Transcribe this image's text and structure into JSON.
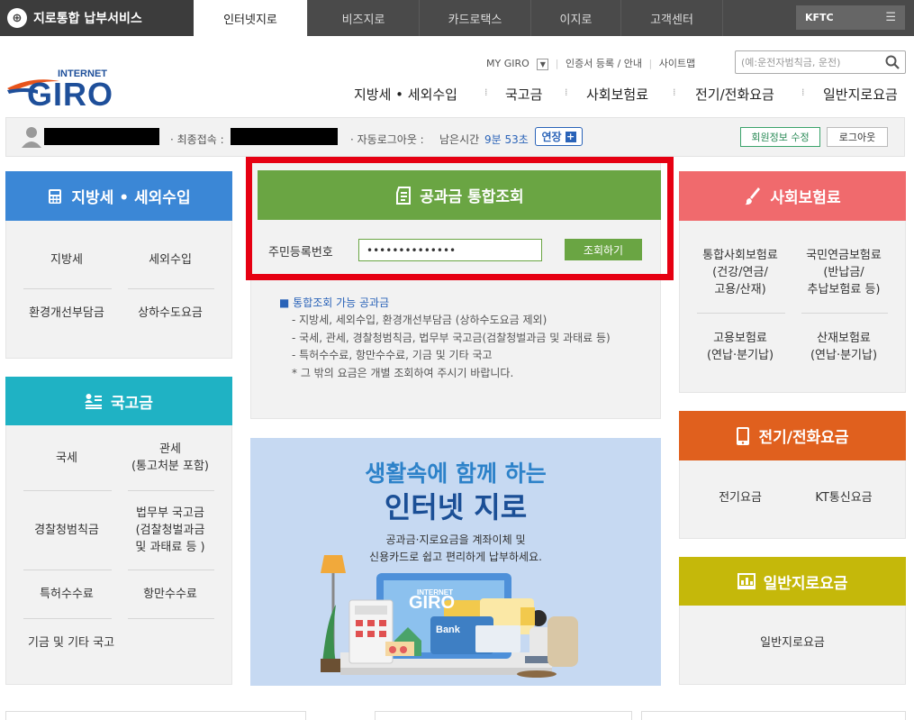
{
  "topbar": {
    "brand": "지로통합 납부서비스",
    "tabs": [
      "인터넷지로",
      "비즈지로",
      "카드로택스",
      "이지로",
      "고객센터"
    ],
    "kftc": "KFTC"
  },
  "header": {
    "logo_small": "INTERNET",
    "logo_big": "GIRO",
    "utility": {
      "my_giro": "MY GIRO",
      "cert": "인증서 등록 / 안내",
      "sitemap": "사이트맵"
    },
    "search_placeholder": "(예:운전자범칙금, 운전)",
    "nav": [
      "지방세 • 세외수입",
      "국고금",
      "사회보험료",
      "전기/전화요금",
      "일반지로요금"
    ]
  },
  "userbar": {
    "last_login_label": "· 최종접속 :",
    "auto_logout_label": "· 자동로그아웃 :",
    "remaining_label": "남은시간",
    "remaining_time": "9분 53초",
    "extend": "연장",
    "edit_member": "회원정보 수정",
    "logout": "로그아웃"
  },
  "local_tax": {
    "title": "지방세 • 세외수입",
    "items": [
      "지방세",
      "세외수입",
      "환경개선부담금",
      "상하수도요금"
    ]
  },
  "national": {
    "title": "국고금",
    "items": [
      "국세",
      "관세\n(통고처분 포함)",
      "경찰청범칙금",
      "법무부 국고금\n(검찰청벌과금\n및 과태료 등 )",
      "특허수수료",
      "항만수수료",
      "기금 및 기타 국고"
    ]
  },
  "inquiry": {
    "title": "공과금 통합조회",
    "id_label": "주민등록번호",
    "id_value": "••••••••••••••",
    "button": "조회하기",
    "notes_title": "■ 통합조회 가능 공과금",
    "notes": [
      "- 지방세, 세외수입, 환경개선부담금 (상하수도요금 제외)",
      "- 국세, 관세, 경찰청범칙금, 법무부 국고금(검찰청벌과금 및 과태료 등)",
      "- 특허수수료, 항만수수료, 기금 및 기타 국고",
      "* 그 밖의 요금은 개별 조회하여 주시기 바랍니다."
    ]
  },
  "banner": {
    "line1": "생활속에 함께 하는",
    "line2": "인터넷 지로",
    "desc1": "공과금·지로요금을 계좌이체 및",
    "desc2": "신용카드로 쉽고 편리하게 납부하세요.",
    "card_small": "INTERNET",
    "card_big": "GIRO",
    "bank": "Bank"
  },
  "social": {
    "title": "사회보험료",
    "items": [
      "통합사회보험료\n(건강/연금/\n고용/산재)",
      "국민연금보험료\n(반납금/\n추납보험료 등)",
      "고용보험료\n(연납·분기납)",
      "산재보험료\n(연납·분기납)"
    ]
  },
  "utility_fee": {
    "title": "전기/전화요금",
    "items": [
      "전기요금",
      "KT통신요금"
    ]
  },
  "general": {
    "title": "일반지로요금",
    "items": [
      "일반지로요금"
    ]
  },
  "colors": {
    "blue": "#3b87d6",
    "teal": "#1fb2c4",
    "green": "#6aa543",
    "pink": "#f06a6d",
    "orange": "#e0601e",
    "yellow": "#c5b80a",
    "red_highlight": "#e60012"
  }
}
